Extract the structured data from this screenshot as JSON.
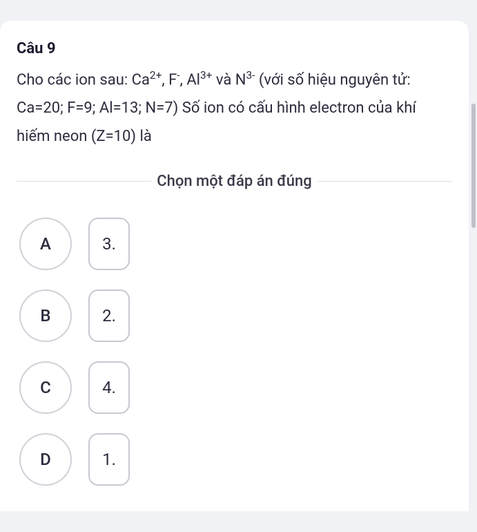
{
  "question": {
    "title": "Câu 9",
    "text_html": "Cho các ion sau: Ca<sup>2+</sup>, F<sup>-</sup>, Al<sup>3+</sup> và N<sup>3-</sup> (với số hiệu nguyên tử: Ca=20; F=9; Al=13; N=7) Số ion có cấu hình electron của khí hiếm neon (Z=10) là"
  },
  "instruction": "Chọn một đáp án đúng",
  "options": [
    {
      "letter": "A",
      "value": "3."
    },
    {
      "letter": "B",
      "value": "2."
    },
    {
      "letter": "C",
      "value": "4."
    },
    {
      "letter": "D",
      "value": "1."
    }
  ]
}
